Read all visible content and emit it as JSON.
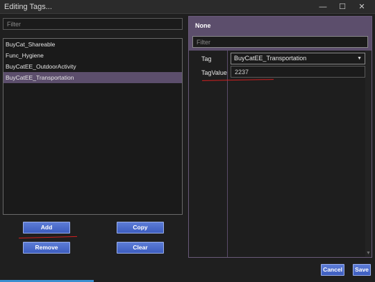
{
  "window": {
    "title": "Editing Tags...",
    "controls": {
      "minimize": "—",
      "maximize": "☐",
      "close": "✕"
    }
  },
  "left": {
    "filter_placeholder": "Filter",
    "tags": [
      {
        "label": "BuyCat_Shareable",
        "selected": false
      },
      {
        "label": "Func_Hygiene",
        "selected": false
      },
      {
        "label": "BuyCatEE_OutdoorActivity",
        "selected": false
      },
      {
        "label": "BuyCatEE_Transportation",
        "selected": true
      }
    ],
    "buttons": {
      "add": "Add",
      "copy": "Copy",
      "remove": "Remove",
      "clear": "Clear"
    }
  },
  "right": {
    "header": "None",
    "filter_placeholder": "Filter",
    "properties": {
      "tag_label": "Tag",
      "tag_value": "BuyCatEE_Transportation",
      "tagvalue_label": "TagValue",
      "tagvalue_value": "2237"
    }
  },
  "footer": {
    "cancel": "Cancel",
    "save": "Save"
  },
  "colors": {
    "selection": "#5c4e6c",
    "button": "#4a6cd0",
    "annotation": "#d42020",
    "background": "#1f1f1f"
  }
}
